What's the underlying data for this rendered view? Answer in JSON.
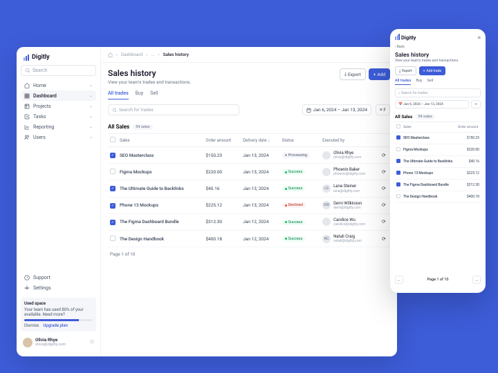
{
  "brand": "Digitly",
  "search_placeholder": "Search",
  "nav": [
    {
      "icon": "home",
      "label": "Home"
    },
    {
      "icon": "dashboard",
      "label": "Dashboard"
    },
    {
      "icon": "projects",
      "label": "Projects"
    },
    {
      "icon": "tasks",
      "label": "Tasks"
    },
    {
      "icon": "reporting",
      "label": "Reporting"
    },
    {
      "icon": "users",
      "label": "Users"
    }
  ],
  "nav_bottom": [
    {
      "icon": "support",
      "label": "Support"
    },
    {
      "icon": "settings",
      "label": "Settings"
    }
  ],
  "used_space": {
    "title": "Used space",
    "text": "Your team has used 80% of your available. Need more?",
    "dismiss": "Dismiss",
    "upgrade": "Upgrade plan"
  },
  "user": {
    "name": "Olivia Rhye",
    "email": "olivia@digitly.com"
  },
  "breadcrumb": {
    "home": "Dashboard",
    "dots": "...",
    "current": "Sales history"
  },
  "page": {
    "title": "Sales history",
    "subtitle": "View your team's trades and transactions."
  },
  "actions": {
    "export": "Export",
    "add": "Add",
    "add_trade": "Add trade"
  },
  "tabs": [
    "All trades",
    "Buy",
    "Sell"
  ],
  "trades_search": "Search for trades",
  "date_range": "Jan 6, 2024 – Jan 13, 2024",
  "filter": "F",
  "all_sales": {
    "label": "All Sales",
    "count": "54 sales"
  },
  "columns": {
    "sales": "Sales",
    "amount": "Order amount",
    "date": "Delivery date",
    "status": "Status",
    "exec": "Executed by"
  },
  "rows": [
    {
      "checked": true,
      "name": "SEO Masterclass",
      "amount": "$150.23",
      "date": "Jan 13, 2024",
      "status": "Processing",
      "stclass": "st-process",
      "exec_name": "Olivia Rhye",
      "exec_email": "olivia@digitly.com",
      "initials": ""
    },
    {
      "checked": false,
      "name": "Figma Mockups",
      "amount": "$220.00",
      "date": "Jan 13, 2024",
      "status": "Success",
      "stclass": "st-success",
      "exec_name": "Phoenix Baker",
      "exec_email": "phoenix@digitly.com",
      "initials": ""
    },
    {
      "checked": true,
      "name": "The Ultimate Guide to Backlinks",
      "amount": "$40.16",
      "date": "Jan 13, 2024",
      "status": "Success",
      "stclass": "st-success",
      "exec_name": "Lana Steiner",
      "exec_email": "lana@digitly.com",
      "initials": "LS"
    },
    {
      "checked": true,
      "name": "Phone 13 Mockups",
      "amount": "$225.12",
      "date": "Jan 13, 2024",
      "status": "Declined",
      "stclass": "st-declined",
      "exec_name": "Demi Wilkinson",
      "exec_email": "demi@digitly.com",
      "initials": "DW"
    },
    {
      "checked": true,
      "name": "The Figma Dashboard Bundle",
      "amount": "$312.30",
      "date": "Jan 12, 2024",
      "status": "Success",
      "stclass": "st-success",
      "exec_name": "Candice Wu",
      "exec_email": "candice@digitly.com",
      "initials": ""
    },
    {
      "checked": false,
      "name": "The Design Handbook",
      "amount": "$400.18",
      "date": "Jan 12, 2024",
      "status": "Success",
      "stclass": "st-success",
      "exec_name": "Natali Craig",
      "exec_email": "natali@digitly.com",
      "initials": "NC"
    }
  ],
  "pagination": "Page 1 of 10",
  "mobile": {
    "back": "Back",
    "rows": [
      {
        "checked": true,
        "name": "SEO Masterclass",
        "amount": "$150.23"
      },
      {
        "checked": false,
        "name": "Figma Mockups",
        "amount": "$220.00"
      },
      {
        "checked": true,
        "name": "The Ultimate Guide to Backlinks",
        "amount": "$40.16"
      },
      {
        "checked": true,
        "name": "Phone 13 Mockups",
        "amount": "$225.12"
      },
      {
        "checked": true,
        "name": "The Figma Dashboard Bundle",
        "amount": "$312.30"
      },
      {
        "checked": false,
        "name": "The Design Handbook",
        "amount": "$400.18"
      }
    ]
  }
}
